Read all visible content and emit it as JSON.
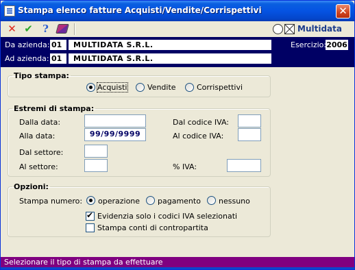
{
  "window": {
    "title": "Stampa elenco fatture Acquisti/Vendite/Corrispettivi",
    "close_symbol": "✕"
  },
  "toolbar": {
    "icons": [
      "cancel-x-icon",
      "confirm-check-icon",
      "help-question-icon",
      "print-book-icon"
    ],
    "cancel_symbol": "✕",
    "confirm_symbol": "✔",
    "help_symbol": "?"
  },
  "brand": {
    "logo_text": "Multidata"
  },
  "header": {
    "from_company_label": "Da azienda:",
    "from_company_code": "01",
    "from_company_name": "MULTIDATA S.R.L.",
    "to_company_label": "Ad azienda:",
    "to_company_code": "01",
    "to_company_name": "MULTIDATA S.R.L.",
    "year_label": "Esercizio:",
    "year_value": "2006"
  },
  "print_type": {
    "legend": "Tipo stampa:",
    "options": [
      "Acquisti",
      "Vendite",
      "Corrispettivi"
    ],
    "selected": "Acquisti"
  },
  "print_range": {
    "legend": "Estremi di stampa:",
    "from_date_label": "Dalla data:",
    "from_date_value": "",
    "to_date_label": "Alla data:",
    "to_date_value": "99/99/9999",
    "from_sector_label": "Dal settore:",
    "from_sector_value": "",
    "to_sector_label": "Al settore:",
    "to_sector_value": "",
    "from_vat_label": "Dal codice IVA:",
    "from_vat_value": "",
    "to_vat_label": "Al codice IVA:",
    "to_vat_value": "",
    "vat_pct_label": "% IVA:",
    "vat_pct_value": ""
  },
  "options": {
    "legend": "Opzioni:",
    "number_label": "Stampa numero:",
    "number_options": [
      "operazione",
      "pagamento",
      "nessuno"
    ],
    "number_selected": "operazione",
    "highlight_label": "Evidenzia solo i codici IVA selezionati",
    "highlight_checked": true,
    "counterpart_label": "Stampa conti di contropartita",
    "counterpart_checked": false
  },
  "status": {
    "text": "Selezionare il tipo di stampa da effettuare"
  },
  "colors": {
    "header_bg": "#000064",
    "status_bg": "#800080",
    "titlebar": "#0553e2",
    "dialog_bg": "#ece9d8"
  }
}
